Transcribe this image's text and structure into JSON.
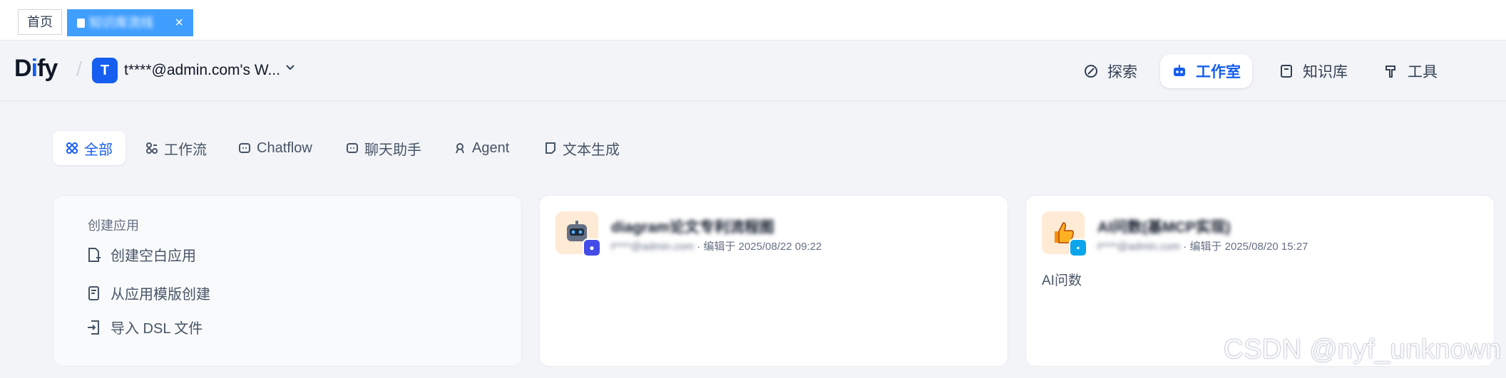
{
  "tabs": {
    "home": "首页",
    "active": "知识库流线",
    "close": "×"
  },
  "header": {
    "logo_d": "D",
    "logo_i": "i",
    "logo_f": "f",
    "logo_y": "y",
    "workspace_initial": "T",
    "workspace_name": "t****@admin.com's W...",
    "nav": {
      "explore": "探索",
      "studio": "工作室",
      "knowledge": "知识库",
      "tools": "工具"
    }
  },
  "filters": {
    "all": "全部",
    "workflow": "工作流",
    "chatflow": "Chatflow",
    "chatbot": "聊天助手",
    "agent": "Agent",
    "completion": "文本生成"
  },
  "create": {
    "title": "创建应用",
    "blank": "创建空白应用",
    "template": "从应用模版创建",
    "import_dsl": "导入 DSL 文件"
  },
  "apps": [
    {
      "name": "diagram论文专利流程图",
      "owner": "t****@admin.com",
      "edited": "· 编辑于 2025/08/22 09:22",
      "description": "",
      "icon": "robot-icon",
      "badge_color": "#444ce7"
    },
    {
      "name": "AI问数(基MCP实现)",
      "owner": "t****@admin.com",
      "edited": "· 编辑于 2025/08/20 15:27",
      "description": "AI问数",
      "icon": "thumbs-up-icon",
      "badge_color": "#0ba5ec"
    }
  ],
  "watermark": "CSDN @nyf_unknown",
  "colors": {
    "accent": "#155eef",
    "tab_active": "#409eff"
  }
}
